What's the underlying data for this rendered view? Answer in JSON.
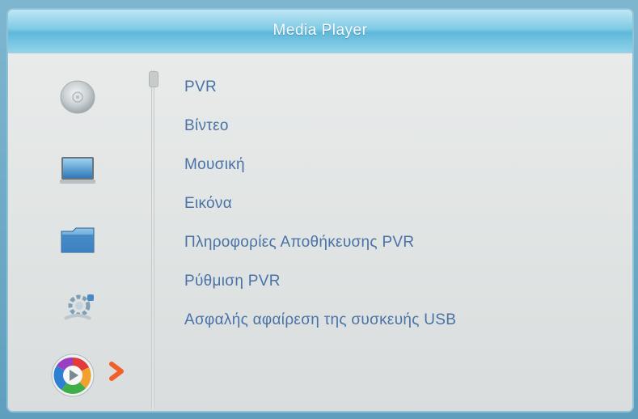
{
  "header": {
    "title": "Media Player"
  },
  "sidebar": {
    "icons": [
      {
        "name": "disc-icon"
      },
      {
        "name": "monitor-icon"
      },
      {
        "name": "folder-icon"
      },
      {
        "name": "settings-gear-icon"
      },
      {
        "name": "media-play-icon",
        "selected": true
      }
    ],
    "selected_indicator": "chevron-right-icon"
  },
  "menu": {
    "items": [
      {
        "label": "PVR"
      },
      {
        "label": "Βίντεο"
      },
      {
        "label": "Μουσική"
      },
      {
        "label": "Εικόνα"
      },
      {
        "label": "Πληροφορίες Αποθήκευσης PVR"
      },
      {
        "label": "Ρύθμιση PVR"
      },
      {
        "label": "Ασφαλής αφαίρεση της συσκευής USB"
      }
    ]
  },
  "colors": {
    "menu_text": "#4a72a6",
    "title_text": "#f7fbff",
    "title_bar": "#7fcbe5",
    "panel_bg": "#dfe3e3",
    "arrow": "#f0612a"
  }
}
